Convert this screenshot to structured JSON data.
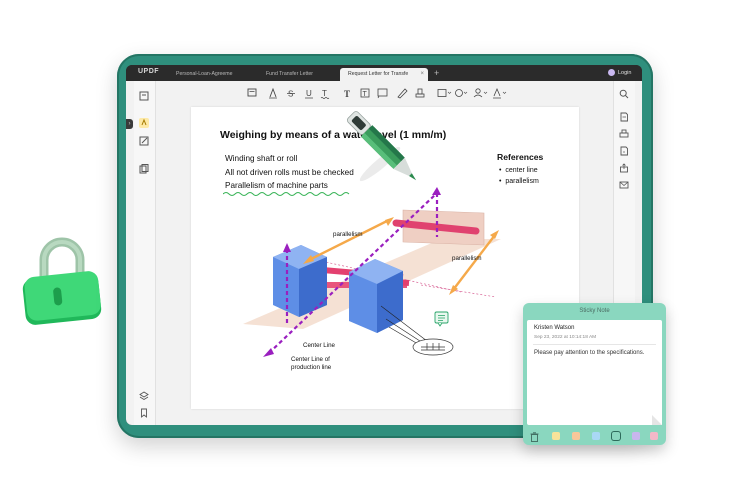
{
  "app": {
    "logo": "UPDF",
    "login_label": "Login",
    "new_tab_symbol": "+"
  },
  "tabs": [
    {
      "label": "Personal-Loan-Agreeme",
      "active": false
    },
    {
      "label": "Fund Transfer Letter",
      "active": false
    },
    {
      "label": "Request Letter for Transfe",
      "active": true,
      "close_symbol": "×"
    }
  ],
  "document": {
    "title": "Weighing by means of a water level (1 mm/m)",
    "lines": [
      "Winding shaft or roll",
      "All not driven rolls must be checked",
      "Parallelism of machine parts"
    ],
    "references_title": "References",
    "references": [
      "center line",
      "parallelism"
    ],
    "bullet": "•",
    "diagram_labels": {
      "parallelism_top": "parallelism",
      "parallelism_right": "parallelism",
      "center_line": "Center Line",
      "center_line_production_1": "Center Line of",
      "center_line_production_2": "production line"
    }
  },
  "sticky_note": {
    "header": "Sticky Note",
    "author": "Kristen Watson",
    "date": "Sep 23, 2022 at 10:14:18 AM",
    "text": "Please pay attention to the specifications.",
    "colors": [
      "#f7e39a",
      "#f9c79a",
      "#a9d8f5",
      "#8ad7bf",
      "#c8b6ee",
      "#f3b8c8"
    ],
    "selected_color": 3
  },
  "colors": {
    "tablet_frame": "#2f8f7d",
    "accent_green": "#2fcf6b",
    "annotation_pink": "#e8326f",
    "annotation_purple": "#9a1fbf",
    "arrow_orange": "#f5a94a"
  },
  "icons": {
    "lock": "lock-icon",
    "pen": "pen-icon",
    "comment": "comment-icon"
  }
}
